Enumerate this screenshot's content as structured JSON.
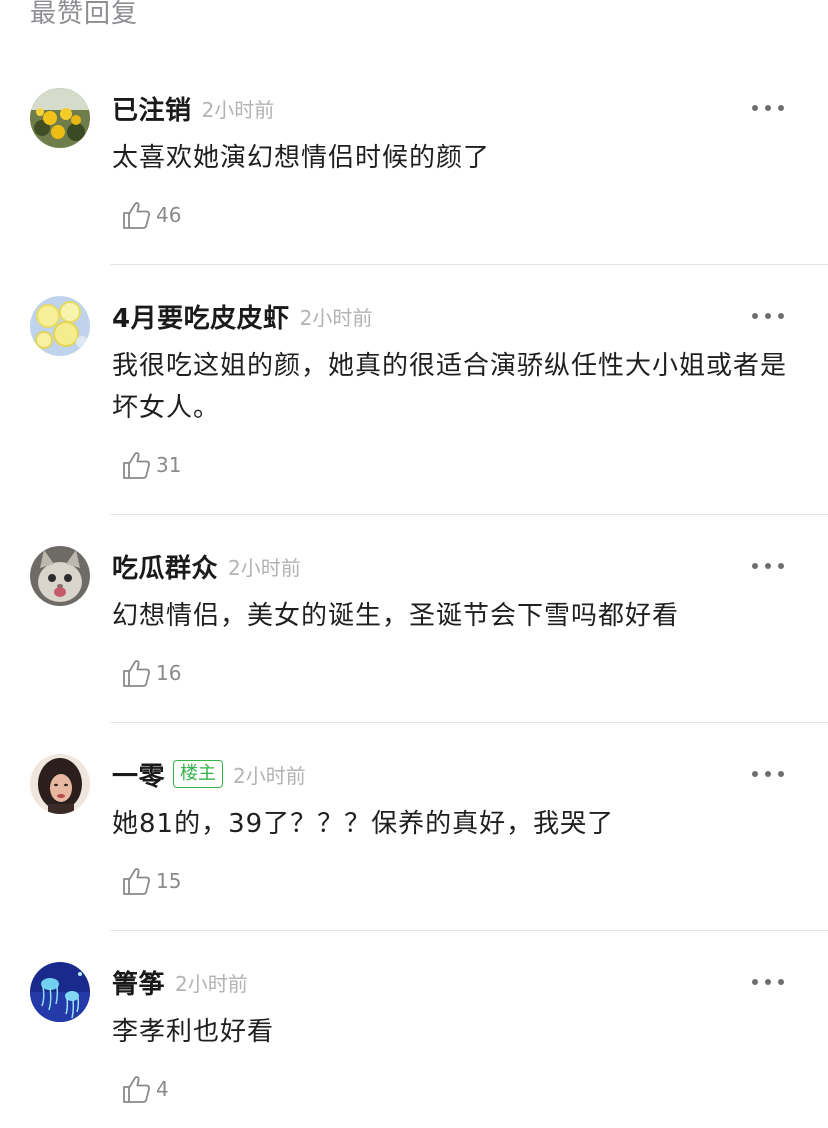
{
  "section_title": "最赞回复",
  "colors": {
    "op_badge": "#35b34a",
    "time": "#b3b3b3",
    "like": "#8a8a8a"
  },
  "comments": [
    {
      "username": "已注销",
      "time": "2小时前",
      "text": "太喜欢她演幻想情侣时候的颜了",
      "likes": "46",
      "avatar_icon": "yellow-roses-avatar"
    },
    {
      "username": "4月要吃皮皮虾",
      "time": "2小时前",
      "text": "我很吃这姐的颜，她真的很适合演骄纵任性大小姐或者是坏女人。",
      "likes": "31",
      "avatar_icon": "lemon-slices-avatar"
    },
    {
      "username": "吃瓜群众",
      "time": "2小时前",
      "text": "幻想情侣，美女的诞生，圣诞节会下雪吗都好看",
      "likes": "16",
      "avatar_icon": "cat-avatar"
    },
    {
      "username": "一零",
      "badge": "楼主",
      "time": "2小时前",
      "text": "她81的，39了？？？保养的真好，我哭了",
      "likes": "15",
      "avatar_icon": "woman-portrait-avatar"
    },
    {
      "username": "箐筝",
      "time": "2小时前",
      "text": "李孝利也好看",
      "likes": "4",
      "avatar_icon": "jellyfish-avatar"
    }
  ]
}
